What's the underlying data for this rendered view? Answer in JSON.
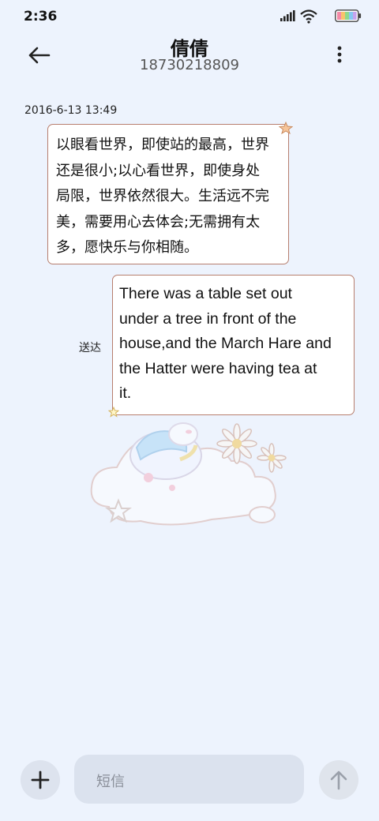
{
  "status_bar": {
    "time": "2:36",
    "icons": [
      "signal-icon",
      "wifi-icon",
      "battery-icon"
    ]
  },
  "header": {
    "contact_name": "倩倩",
    "contact_number": "18730218809",
    "back_icon": "arrow-left-icon",
    "more_icon": "more-vertical-icon"
  },
  "conversation": {
    "timestamp": "2016-6-13 13:49",
    "messages": [
      {
        "direction": "incoming",
        "lines": [
          "以眼看世界，即使站的最高，世界",
          "还是很小;以心看世界，即使身处",
          "局限，世界依然很大。生活远不完",
          "美，需要用心去体会;无需拥有太",
          "多，愿快乐与你相随。"
        ]
      },
      {
        "direction": "outgoing",
        "lines": [
          "There was a table set out",
          "under a tree in front of the",
          "house,and the March Hare and",
          "the Hatter were having tea at",
          "it."
        ],
        "status": "送达"
      }
    ]
  },
  "input_bar": {
    "add_icon": "plus-icon",
    "placeholder": "短信",
    "send_icon": "arrow-up-icon"
  },
  "colors": {
    "background": "#edf3fd",
    "bubble_border": "#b77e6e",
    "bubble_fill": "#ffffff",
    "input_fill": "#dbe2ee"
  }
}
